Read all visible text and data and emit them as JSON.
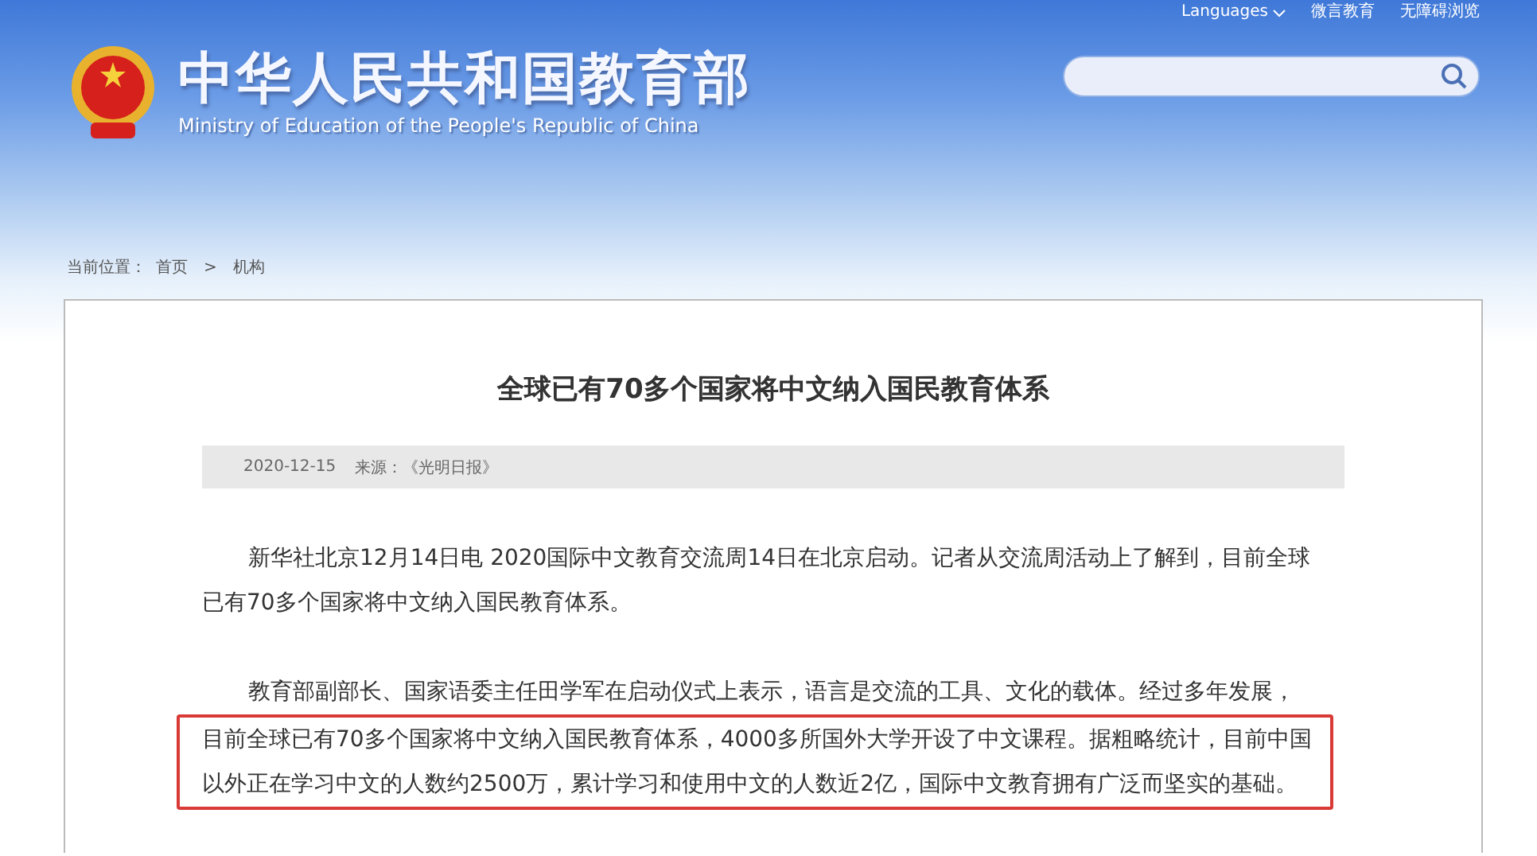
{
  "top_links": [
    "Languages",
    "微言教育",
    "无障碍浏览"
  ],
  "header": {
    "title": "中华人民共和国教育部",
    "subtitle": "Ministry of Education of the People's Republic of China"
  },
  "breadcrumb": {
    "label": "当前位置：",
    "items": [
      "首页",
      "机构"
    ],
    "separator": ">"
  },
  "article": {
    "title": "全球已有70多个国家将中文纳入国民教育体系",
    "date": "2020-12-15",
    "source": "来源：《光明日报》",
    "paragraphs": [
      {
        "lines": [
          {
            "text": "新华社北京12月14日电 2020国际中文教育交流周14日在北京启动。记者从交流周活动上了解到，目前全球",
            "highlighted": false
          },
          {
            "text": "已有70多个国家将中文纳入国民教育体系。",
            "highlighted": false
          }
        ]
      },
      {
        "lines": [
          {
            "text": "教育部副部长、国家语委主任田学军在启动仪式上表示，语言是交流的工具、文化的载体。经过多年发展，",
            "highlighted": false
          },
          {
            "text": "目前全球已有70多个国家将中文纳入国民教育体系，4000多所国外大学开设了中文课程。据粗略统计，目前中国",
            "highlighted": true
          },
          {
            "text": "以外正在学习中文的人数约2500万，累计学习和使用中文的人数近2亿，国际中文教育拥有广泛而坚实的基础。",
            "highlighted": true
          }
        ]
      }
    ]
  }
}
